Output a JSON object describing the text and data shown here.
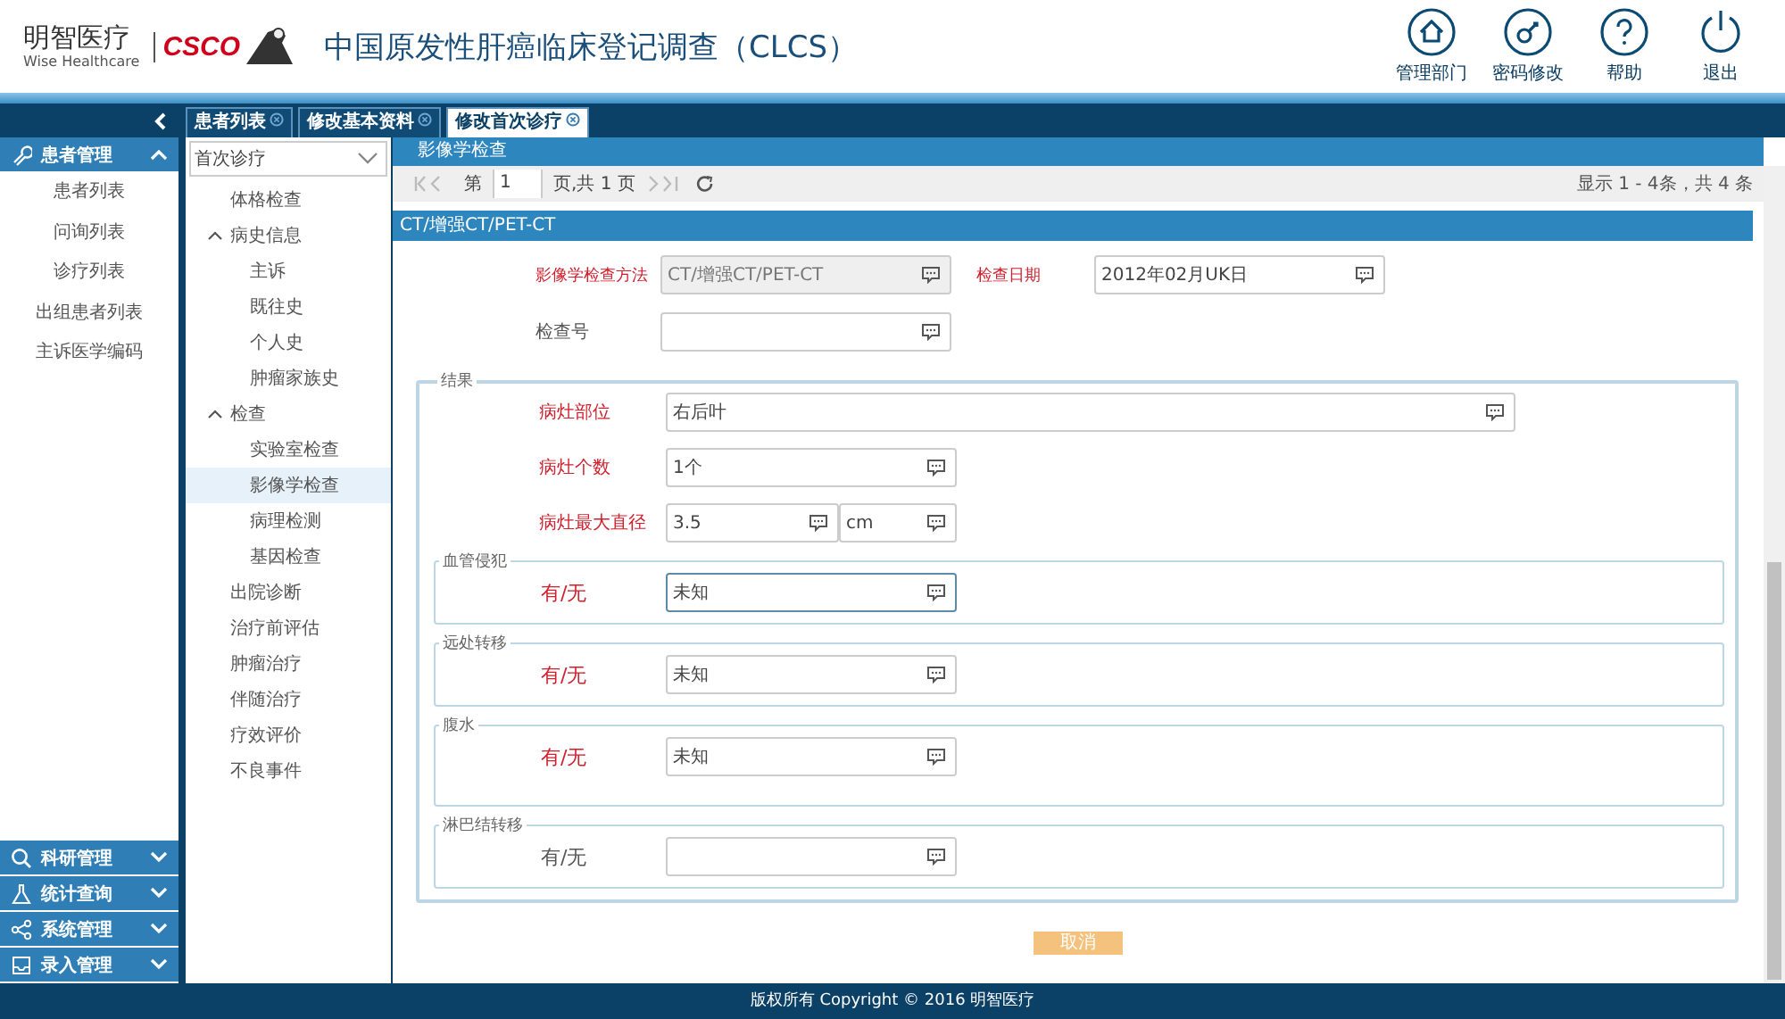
{
  "header": {
    "brand": "明智医疗",
    "brand_sub": "Wise Healthcare",
    "partner": "CSCO",
    "title": "中国原发性肝癌临床登记调查（CLCS）",
    "actions": [
      {
        "kind": "home",
        "label": "管理部门"
      },
      {
        "kind": "key",
        "label": "密码修改"
      },
      {
        "kind": "help",
        "label": "帮助"
      },
      {
        "kind": "power",
        "label": "退出"
      }
    ]
  },
  "tabs": [
    {
      "label": "患者列表",
      "selected": false
    },
    {
      "label": "修改基本资料",
      "selected": false
    },
    {
      "label": "修改首次诊疗",
      "selected": true
    }
  ],
  "sidebar": {
    "sections": [
      {
        "kind": "wrench",
        "label": "患者管理",
        "expanded": true,
        "items": [
          "患者列表",
          "问询列表",
          "诊疗列表",
          "出组患者列表",
          "主诉医学编码"
        ]
      },
      {
        "kind": "search",
        "label": "科研管理",
        "expanded": false
      },
      {
        "kind": "flask",
        "label": "统计查询",
        "expanded": false
      },
      {
        "kind": "share",
        "label": "系统管理",
        "expanded": false
      },
      {
        "kind": "tray",
        "label": "录入管理",
        "expanded": false
      }
    ]
  },
  "nav": {
    "select": "首次诊疗",
    "tree": [
      {
        "label": "体格检查",
        "selected": false
      },
      {
        "label": "病史信息",
        "selected": false,
        "expanded": true,
        "children": [
          {
            "label": "主诉",
            "selected": false
          },
          {
            "label": "既往史",
            "selected": false
          },
          {
            "label": "个人史",
            "selected": false
          },
          {
            "label": "肿瘤家族史",
            "selected": false
          }
        ]
      },
      {
        "label": "检查",
        "selected": false,
        "expanded": true,
        "children": [
          {
            "label": "实验室检查",
            "selected": false
          },
          {
            "label": "影像学检查",
            "selected": true
          },
          {
            "label": "病理检测",
            "selected": false
          },
          {
            "label": "基因检查",
            "selected": false
          }
        ]
      },
      {
        "label": "出院诊断",
        "selected": false
      },
      {
        "label": "治疗前评估",
        "selected": false
      },
      {
        "label": "肿瘤治疗",
        "selected": false
      },
      {
        "label": "伴随治疗",
        "selected": false
      },
      {
        "label": "疗效评价",
        "selected": false
      },
      {
        "label": "不良事件",
        "selected": false
      }
    ]
  },
  "content": {
    "panel_title": "影像学检查",
    "pager": {
      "page_prefix": "第",
      "page": "1",
      "page_suffix": "页,共 1 页",
      "summary": "显示 1 - 4条，共 4 条"
    },
    "section_title": "CT/增强CT/PET-CT",
    "top_fields": [
      {
        "label": "影像学检查方法",
        "required": true,
        "value": "CT/增强CT/PET-CT",
        "disabled": true
      },
      {
        "label": "检查日期",
        "required": true,
        "value": "2012年02月UK日",
        "disabled": false
      },
      {
        "label": "检查号",
        "required": false,
        "disabled": false
      }
    ],
    "result": {
      "legend": "结果",
      "fields": [
        {
          "kind": "wide",
          "label": "病灶部位",
          "required": true,
          "value": "右后叶"
        },
        {
          "kind": "single",
          "label": "病灶个数",
          "required": true,
          "value": "1个"
        },
        {
          "kind": "unit",
          "label": "病灶最大直径",
          "required": true,
          "value": "3.5",
          "unit": "cm"
        }
      ],
      "groups": [
        {
          "legend": "血管侵犯",
          "label": "有/无",
          "required": true,
          "value": "未知",
          "focused": true
        },
        {
          "legend": "远处转移",
          "label": "有/无",
          "required": true,
          "value": "未知",
          "focused": false
        },
        {
          "legend": "腹水",
          "label": "有/无",
          "required": true,
          "value": "未知",
          "focused": false
        },
        {
          "legend": "淋巴结转移",
          "label": "有/无",
          "required": false,
          "focused": false
        }
      ]
    },
    "cancel": "取消"
  },
  "footer": "版权所有 Copyright © 2016 明智医疗"
}
